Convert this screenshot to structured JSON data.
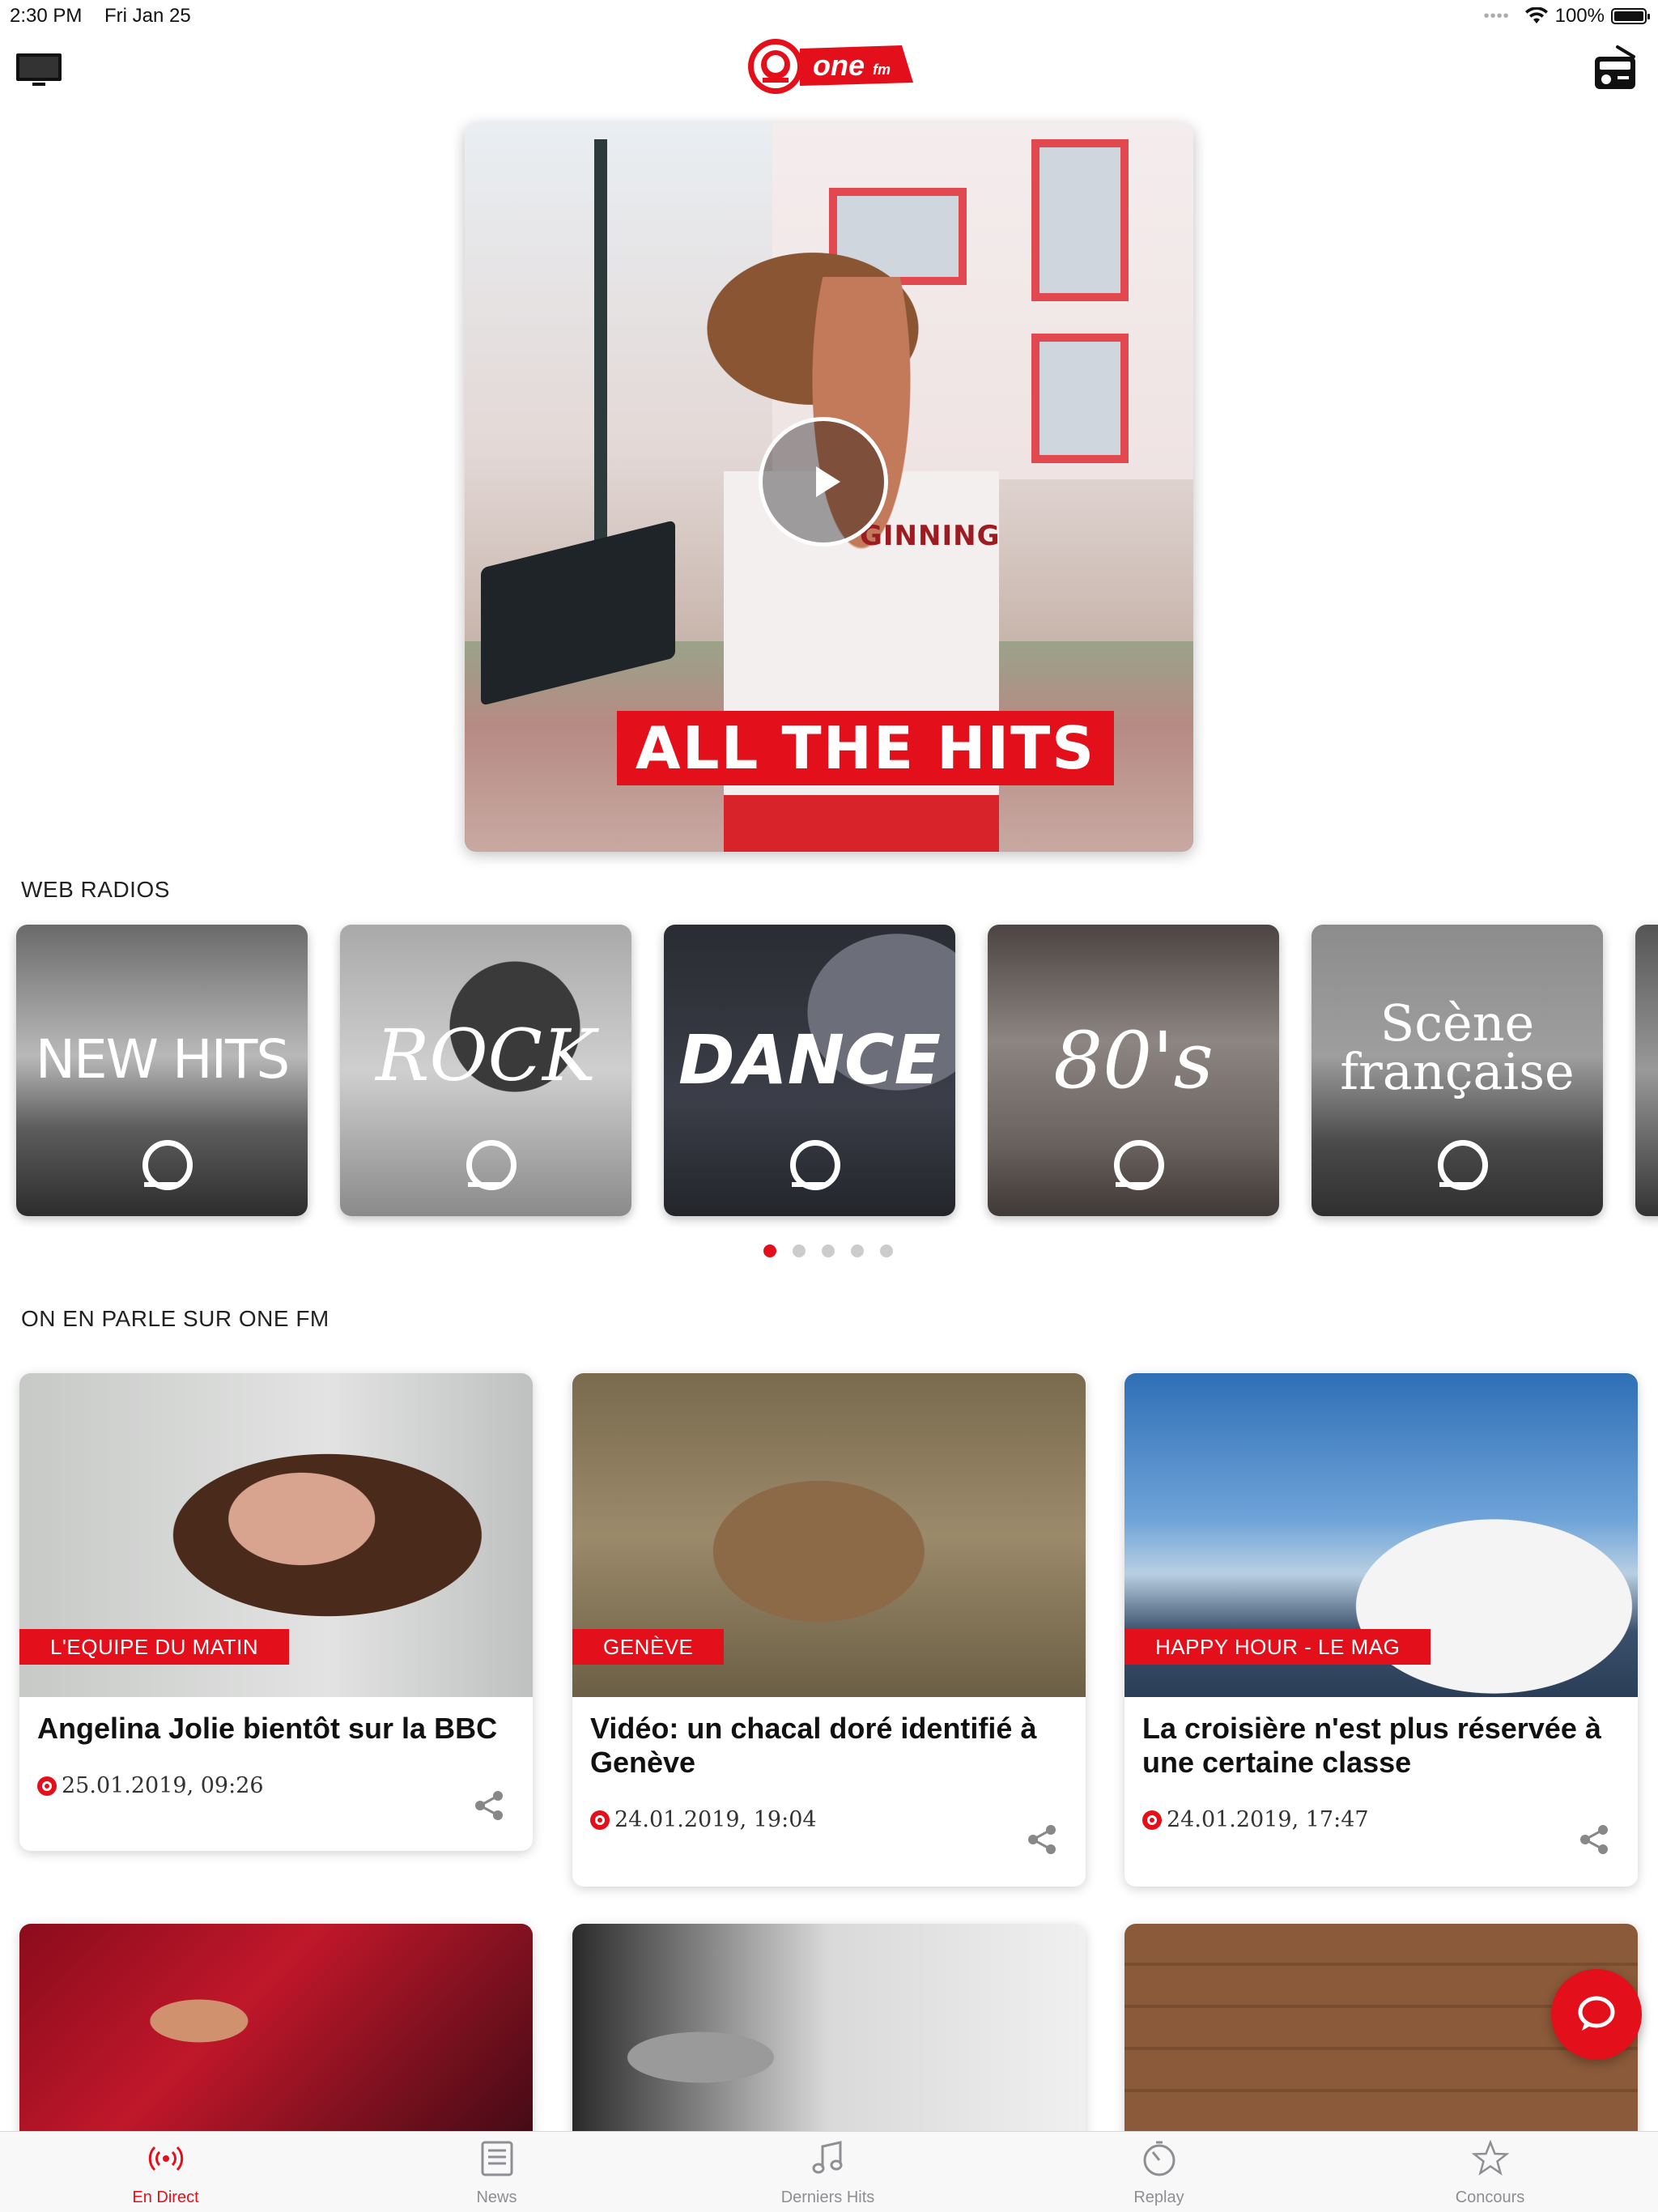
{
  "status_bar": {
    "time": "2:30 PM",
    "date": "Fri Jan 25",
    "battery": "100%",
    "battery_level": 1.0
  },
  "header": {
    "logo_text": "one",
    "logo_suffix": "fm",
    "left_icon": "tv-icon",
    "right_icon": "radio-icon"
  },
  "hero": {
    "banner_text": "ALL THE HITS",
    "shirt_text": "GINNING",
    "play_icon": "play-icon"
  },
  "web_radios": {
    "title": "WEB RADIOS",
    "items": [
      {
        "label": "NEW HITS"
      },
      {
        "label": "ROCK"
      },
      {
        "label": "DANCE"
      },
      {
        "label": "80's"
      },
      {
        "label": "Scène française"
      }
    ],
    "pages": 5,
    "active_page": 1
  },
  "news": {
    "title": "ON EN PARLE SUR ONE FM",
    "cards": [
      {
        "tag": "L'EQUIPE DU MATIN",
        "headline": "Angelina Jolie bientôt sur la BBC",
        "date": "25.01.2019, 09:26"
      },
      {
        "tag": "GENÈVE",
        "headline": "Vidéo: un chacal doré identifié à Genève",
        "date": "24.01.2019, 19:04"
      },
      {
        "tag": "HAPPY HOUR - LE MAG",
        "headline": "La croisière n'est plus réservée à une certaine classe",
        "date": "24.01.2019, 17:47"
      }
    ]
  },
  "tabs": [
    {
      "label": "En Direct",
      "icon": "broadcast-icon",
      "active": true
    },
    {
      "label": "News",
      "icon": "newspaper-icon",
      "active": false
    },
    {
      "label": "Derniers Hits",
      "icon": "music-note-icon",
      "active": false
    },
    {
      "label": "Replay",
      "icon": "stopwatch-icon",
      "active": false
    },
    {
      "label": "Concours",
      "icon": "star-icon",
      "active": false
    }
  ],
  "colors": {
    "accent": "#e3101b",
    "tab_inactive": "#8e8e93"
  }
}
